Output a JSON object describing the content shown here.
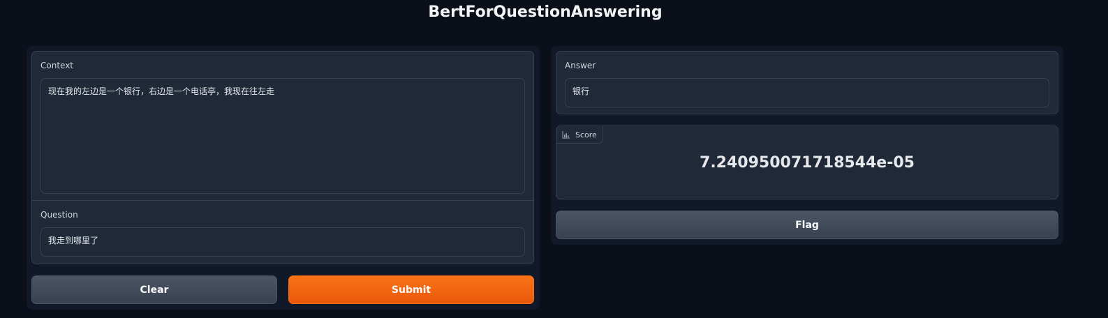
{
  "app": {
    "title": "BertForQuestionAnswering"
  },
  "inputs": {
    "context_label": "Context",
    "context_value": "现在我的左边是一个银行，右边是一个电话亭，我现在往左走",
    "question_label": "Question",
    "question_value": "我走到哪里了"
  },
  "actions": {
    "clear_label": "Clear",
    "submit_label": "Submit",
    "flag_label": "Flag"
  },
  "outputs": {
    "answer_label": "Answer",
    "answer_value": "银行",
    "score_label": "Score",
    "score_value": "7.240950071718544e-05"
  },
  "icons": {
    "score_tag_icon": "bar-chart-icon"
  },
  "colors": {
    "background": "#0b0f19",
    "panel": "#111827",
    "card": "#1f2937",
    "border": "#374151",
    "primary": "#f97316",
    "secondary": "#4b5563"
  }
}
